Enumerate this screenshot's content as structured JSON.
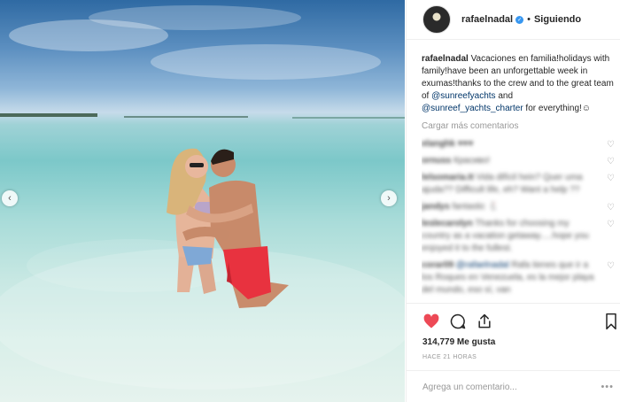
{
  "post": {
    "username": "rafaelnadal",
    "separator": "•",
    "follow_status": "Siguiendo",
    "caption": {
      "username": "rafaelnadal",
      "text_1": " Vacaciones en familia!holidays with family!have been an unforgettable week in exumas!thanks to the crew and to the great team of ",
      "mention_1": "@sunreefyachts",
      "text_2": " and ",
      "mention_2": "@sunreef_yachts_charter",
      "text_3": " for everything!☺"
    },
    "load_more_label": "Cargar más comentarios",
    "comments": [
      {
        "user": "elanghk",
        "text": "♥♥♥",
        "blurred": true
      },
      {
        "user": "ornuss",
        "text": "Крaсиво!",
        "blurred": true
      },
      {
        "user": "lelsomaria.tt",
        "text": "Vida difícil hein? Quer uma ajuda?? Difficult life, eh? Want a help ??",
        "blurred": true
      },
      {
        "user": "jandys",
        "text": "fantastic 🐇",
        "blurred": true
      },
      {
        "user": "leslecarolyn",
        "text": "Thanks for choosing my country as a vacation getaway.....hope you enjoyed it to the fullest.",
        "blurred": true
      },
      {
        "user": "corar09",
        "mention": "@rafaelnadal",
        "text": " Rafa tienes que ir a los Roques en Venezuela, es la mejor playa del mundo, eso sí, van",
        "blurred": true
      }
    ],
    "heart_glyph": "♡",
    "actions": {
      "like_icon": "heart-filled-icon",
      "comment_icon": "comment-bubble-icon",
      "share_icon": "share-icon",
      "save_icon": "bookmark-icon"
    },
    "likes_text": "314,779 Me gusta",
    "timestamp": "HACE 21 HORAS",
    "add_comment_placeholder": "Agrega un comentario...",
    "more_glyph": "•••",
    "colors": {
      "like": "#ed4956",
      "verified": "#3897f0",
      "link": "#003569"
    },
    "nav": {
      "prev": "‹",
      "next": "›"
    }
  }
}
